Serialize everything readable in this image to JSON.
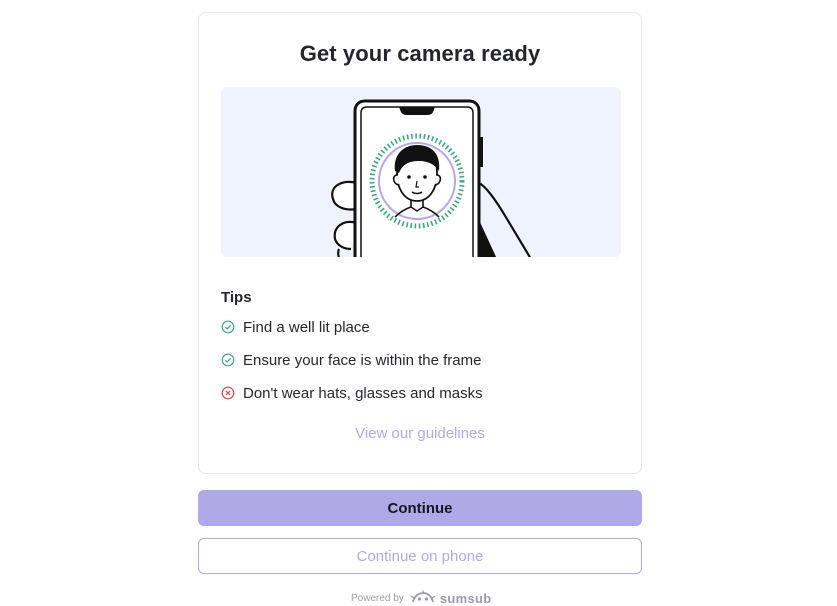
{
  "header": {
    "title": "Get your camera ready"
  },
  "illustration": {
    "icon": "phone-selfie-illustration",
    "background": "#eff3fd"
  },
  "tips": {
    "title": "Tips",
    "items": [
      {
        "label": "Find a well lit place",
        "status": "ok",
        "icon": "check-circle-icon",
        "color": "#3aa981"
      },
      {
        "label": "Ensure your face is within the frame",
        "status": "ok",
        "icon": "check-circle-icon",
        "color": "#3aa981"
      },
      {
        "label": "Don't wear hats, glasses and masks",
        "status": "error",
        "icon": "x-circle-icon",
        "color": "#e0454d"
      }
    ]
  },
  "links": {
    "guidelines": "View our guidelines"
  },
  "buttons": {
    "continue": "Continue",
    "continue_on_phone": "Continue on phone"
  },
  "footer": {
    "powered_by": "Powered by",
    "brand": "sumsub"
  },
  "colors": {
    "accent": "#b1a8e8",
    "link": "#b0a8e6"
  }
}
